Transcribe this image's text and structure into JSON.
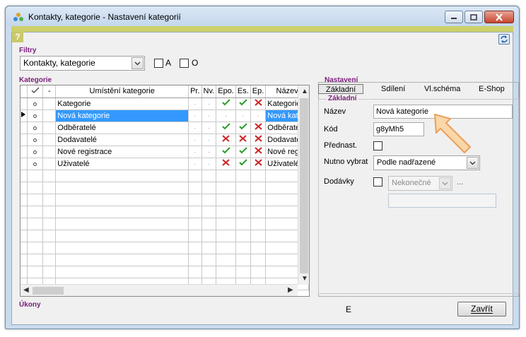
{
  "window": {
    "title": "Kontakty, kategorie - Nastavení kategorií"
  },
  "toolbar": {
    "help_label": "?"
  },
  "filters": {
    "label": "Filtry",
    "combo_value": "Kontakty, kategorie",
    "check_a_label": "A",
    "check_o_label": "O"
  },
  "categories": {
    "label": "Kategorie",
    "columns": [
      "-",
      "Umístění kategorie",
      "Pr.",
      "Nv.",
      "Epo.",
      "Es.",
      "Ep.",
      "Název"
    ],
    "rows": [
      {
        "name": "Kategorie",
        "nazev": "Kategorie",
        "epo": "check",
        "es": "check",
        "ep": "cross",
        "selected": false
      },
      {
        "name": "Nová kategorie",
        "nazev": "Nová kateg",
        "epo": "dot",
        "es": "dot",
        "ep": "dot",
        "selected": true
      },
      {
        "name": "Odběratelé",
        "nazev": "Odběratelé",
        "epo": "check",
        "es": "check",
        "ep": "cross",
        "selected": false
      },
      {
        "name": "Dodavatelé",
        "nazev": "Dodavatelé",
        "epo": "cross",
        "es": "cross",
        "ep": "cross",
        "selected": false
      },
      {
        "name": "Nové registrace",
        "nazev": "Nové regis",
        "epo": "check",
        "es": "check",
        "ep": "cross",
        "selected": false
      },
      {
        "name": "Uživatelé",
        "nazev": "Uživatelé",
        "epo": "cross",
        "es": "check",
        "ep": "cross",
        "selected": false
      }
    ]
  },
  "settings": {
    "label": "Nastavení",
    "tabs": [
      "Základní",
      "Sdílení",
      "Vl.schéma",
      "E-Shop"
    ],
    "group_label": "Základní",
    "nazev_label": "Název",
    "nazev_value": "Nová kategorie",
    "kod_label": "Kód",
    "kod_value": "g8yMh5",
    "prednast_label": "Přednast.",
    "nutno_label": "Nutno vybrat",
    "nutno_value": "Podle nadřazené",
    "dodavky_label": "Dodávky",
    "dodavky_value": "Nekonečné",
    "ellipsis": "..."
  },
  "actions": {
    "label": "Úkony",
    "e_text": "E",
    "close_label": "Zavřít"
  },
  "colors": {
    "accent_label": "#7a1e7a",
    "selection": "#3399ff",
    "check": "#2a9a2a",
    "cross": "#cc2222"
  }
}
